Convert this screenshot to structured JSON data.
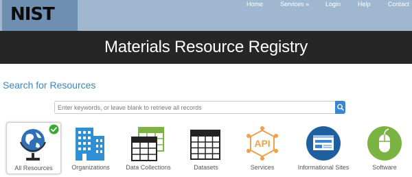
{
  "brand": {
    "logo_text": "NIST"
  },
  "nav": {
    "items": [
      {
        "label": "Home"
      },
      {
        "label": "Services »"
      },
      {
        "label": "Login"
      },
      {
        "label": "Help"
      },
      {
        "label": "Contact"
      }
    ]
  },
  "header": {
    "title": "Materials Resource Registry"
  },
  "search": {
    "heading": "Search for Resources",
    "placeholder": "Enter keywords, or leave blank to retrieve all records",
    "value": ""
  },
  "categories": [
    {
      "label": "All Resources",
      "icon": "globe-icon",
      "selected": true
    },
    {
      "label": "Organizations",
      "icon": "building-icon",
      "selected": false
    },
    {
      "label": "Data Collections",
      "icon": "data-collections-icon",
      "selected": false
    },
    {
      "label": "Datasets",
      "icon": "dataset-grid-icon",
      "selected": false
    },
    {
      "label": "Services",
      "icon": "api-icon",
      "selected": false
    },
    {
      "label": "Informational Sites",
      "icon": "website-icon",
      "selected": false
    },
    {
      "label": "Software",
      "icon": "mouse-icon",
      "selected": false
    }
  ],
  "colors": {
    "topbar": "#9fb8d0",
    "titlebar": "#262626",
    "accent": "#3c86c4",
    "check": "#3aa935"
  }
}
